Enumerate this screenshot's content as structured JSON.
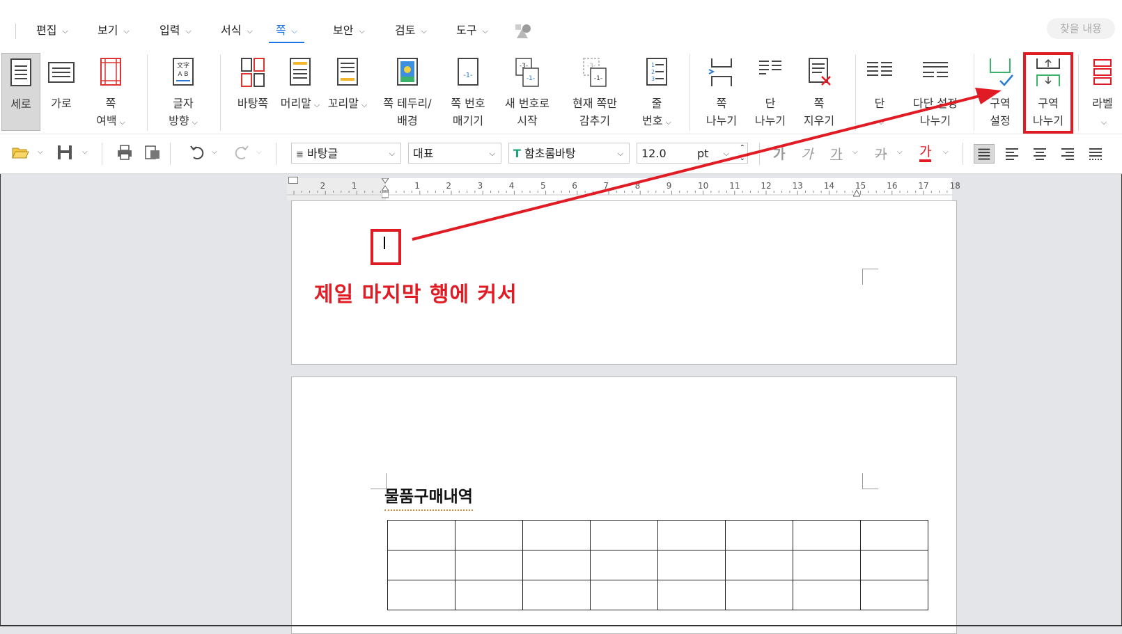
{
  "menu": {
    "items": [
      {
        "label": "편집"
      },
      {
        "label": "보기"
      },
      {
        "label": "입력"
      },
      {
        "label": "서식"
      },
      {
        "label": "쪽"
      },
      {
        "label": "보안"
      },
      {
        "label": "검토"
      },
      {
        "label": "도구"
      }
    ],
    "search_placeholder": "찾을 내용"
  },
  "ribbon": {
    "buttons": [
      {
        "label": "세로"
      },
      {
        "label": "가로"
      },
      {
        "label": "쪽\n여백"
      },
      {
        "label": "글자\n방향"
      },
      {
        "label": "바탕쪽"
      },
      {
        "label": "머리말"
      },
      {
        "label": "꼬리말"
      },
      {
        "label": "쪽 테두리/\n배경"
      },
      {
        "label": "쪽 번호\n매기기"
      },
      {
        "label": "새 번호로\n시작"
      },
      {
        "label": "현재 쪽만\n감추기"
      },
      {
        "label": "줄\n번호"
      },
      {
        "label": "쪽\n나누기"
      },
      {
        "label": "단\n나누기"
      },
      {
        "label": "쪽\n지우기"
      },
      {
        "label": "단"
      },
      {
        "label": "다단 설정\n나누기"
      },
      {
        "label": "구역\n설정"
      },
      {
        "label": "구역\n나누기"
      },
      {
        "label": "라벨"
      }
    ]
  },
  "toolbar": {
    "style": "바탕글",
    "lang": "대표",
    "font": "함초롬바탕",
    "size": "12.0",
    "unit": "pt",
    "fmt_bold": "가",
    "fmt_italic": "가",
    "fmt_underline": "가",
    "fmt_strike": "가",
    "fmt_color": "가"
  },
  "ruler": {
    "numbers": [
      "2",
      "1",
      "1",
      "2",
      "3",
      "4",
      "5",
      "6",
      "7",
      "8",
      "9",
      "10",
      "11",
      "12",
      "13",
      "14",
      "15",
      "16",
      "17",
      "18"
    ]
  },
  "document": {
    "annotation": "제일 마지막 행에 커서",
    "page2_title": "물품구매내역"
  },
  "colors": {
    "accent": "#1a73e8",
    "highlight": "#e01b24"
  }
}
